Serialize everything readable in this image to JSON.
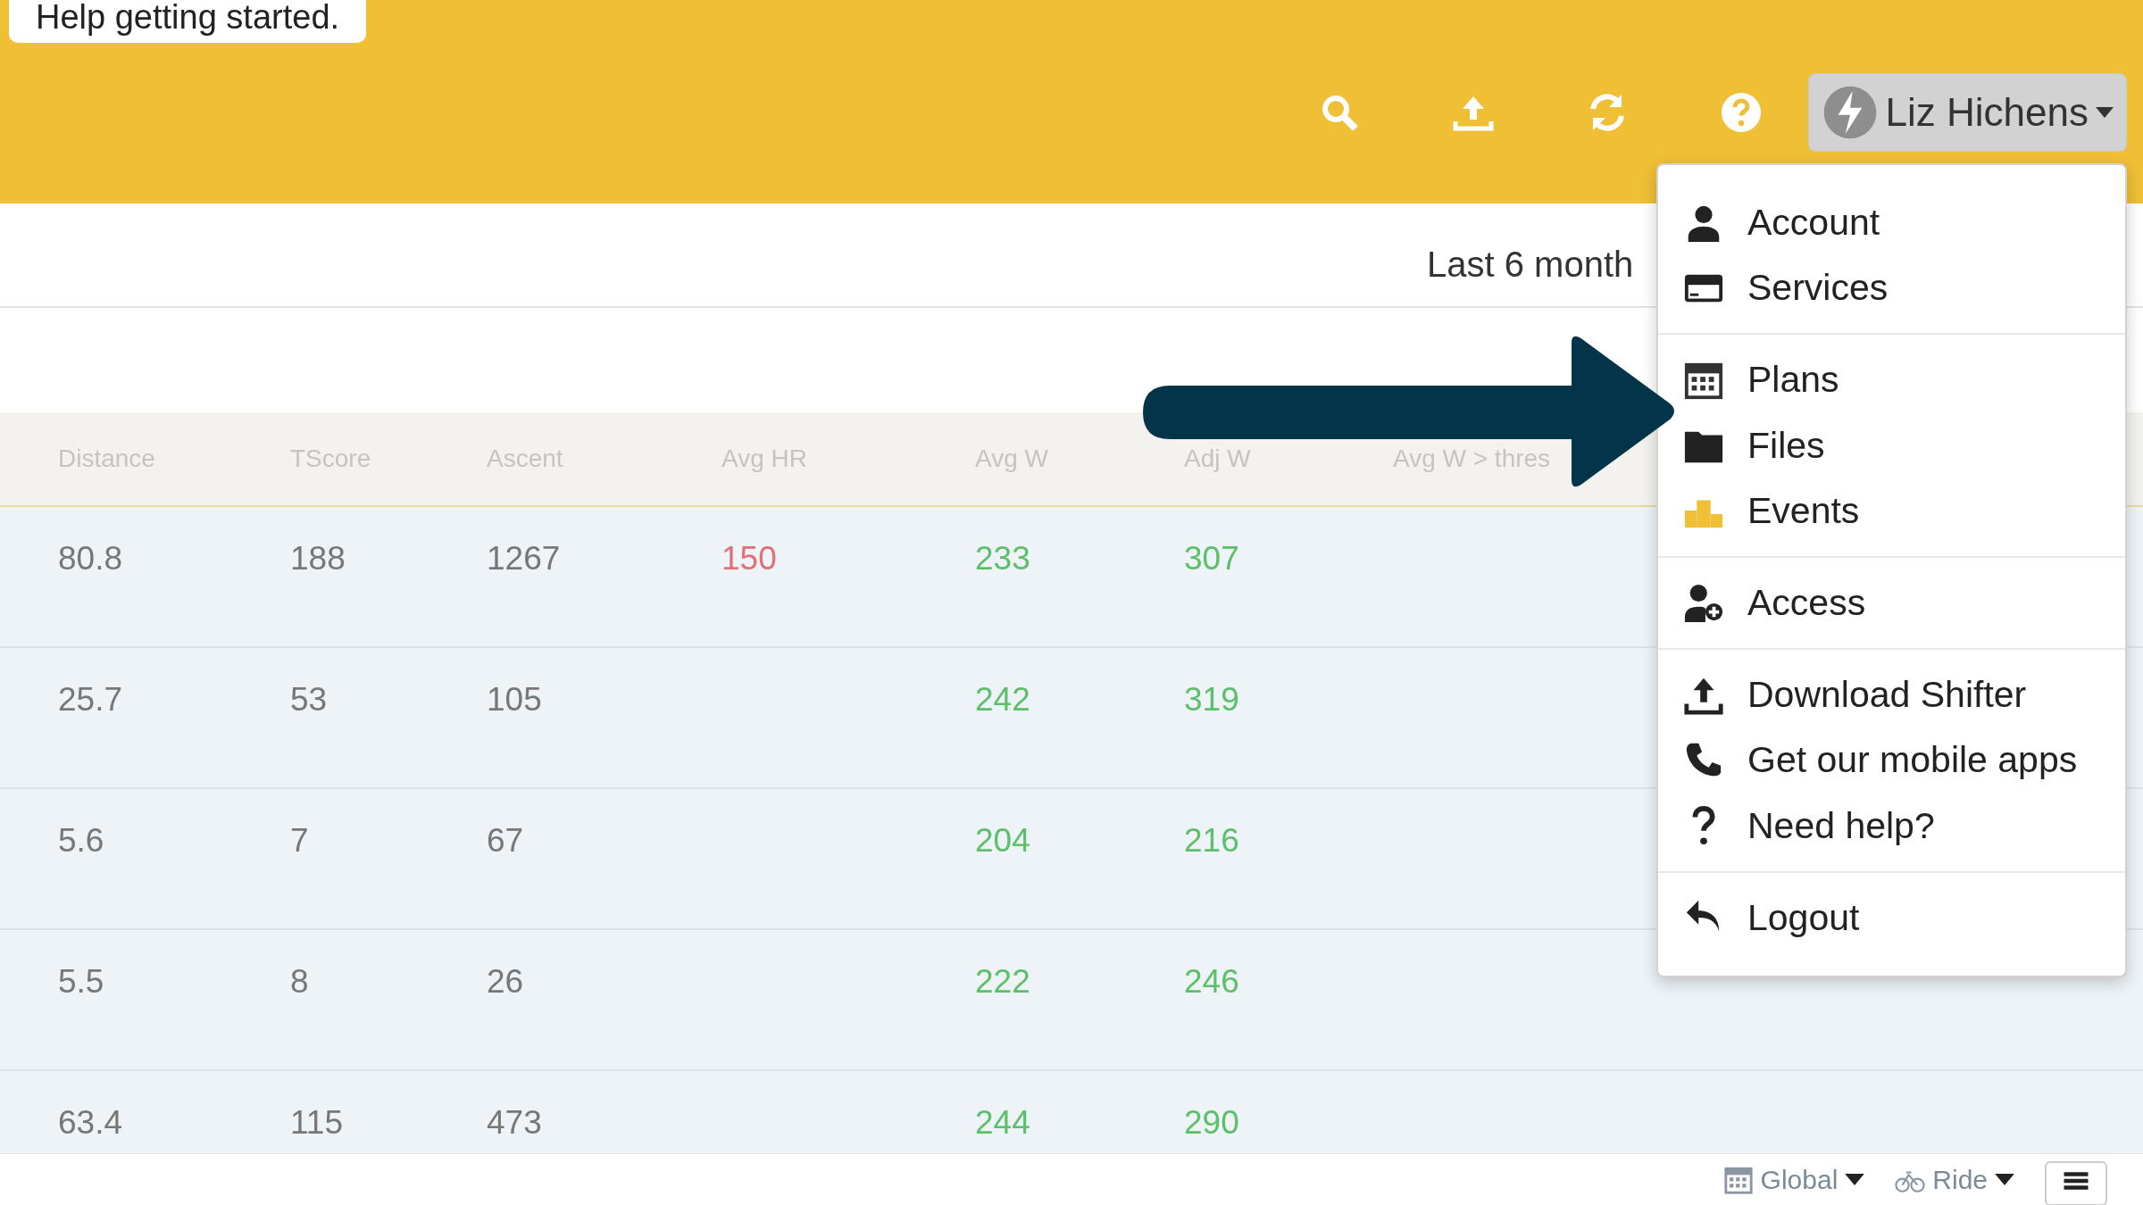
{
  "help_tooltip": "Help getting started.",
  "user_menu": {
    "name": "Liz Hichens",
    "expanded": true
  },
  "date_range": "Last 6 month",
  "table": {
    "columns": [
      "Distance",
      "TScore",
      "Ascent",
      "Avg HR",
      "Avg W",
      "Adj W",
      "Avg W > thres"
    ],
    "rows": [
      {
        "distance": "80.8",
        "tscore": "188",
        "ascent": "1267",
        "avg_hr": "150",
        "avg_w": "233",
        "adj_w": "307"
      },
      {
        "distance": "25.7",
        "tscore": "53",
        "ascent": "105",
        "avg_w": "242",
        "adj_w": "319"
      },
      {
        "distance": "5.6",
        "tscore": "7",
        "ascent": "67",
        "avg_w": "204",
        "adj_w": "216"
      },
      {
        "distance": "5.5",
        "tscore": "8",
        "ascent": "26",
        "avg_w": "222",
        "adj_w": "246"
      },
      {
        "distance": "63.4",
        "tscore": "115",
        "ascent": "473",
        "avg_w": "244",
        "adj_w": "290"
      }
    ]
  },
  "menu": {
    "groups": [
      [
        {
          "label": "Account",
          "kind": "person"
        },
        {
          "label": "Services",
          "kind": "card"
        }
      ],
      [
        {
          "label": "Plans",
          "kind": "calendar"
        },
        {
          "label": "Files",
          "kind": "folder"
        },
        {
          "label": "Events",
          "kind": "podium"
        }
      ],
      [
        {
          "label": "Access",
          "kind": "person-add"
        }
      ],
      [
        {
          "label": "Download Shifter",
          "kind": "upload"
        },
        {
          "label": "Get our mobile apps",
          "kind": "phone"
        },
        {
          "label": "Need help?",
          "kind": "question"
        }
      ],
      [
        {
          "label": "Logout",
          "kind": "undo"
        }
      ]
    ]
  },
  "bottom_bar": {
    "filters": [
      {
        "label": "Global",
        "kind": "calendar"
      },
      {
        "label": "Ride",
        "kind": "bike"
      }
    ]
  }
}
